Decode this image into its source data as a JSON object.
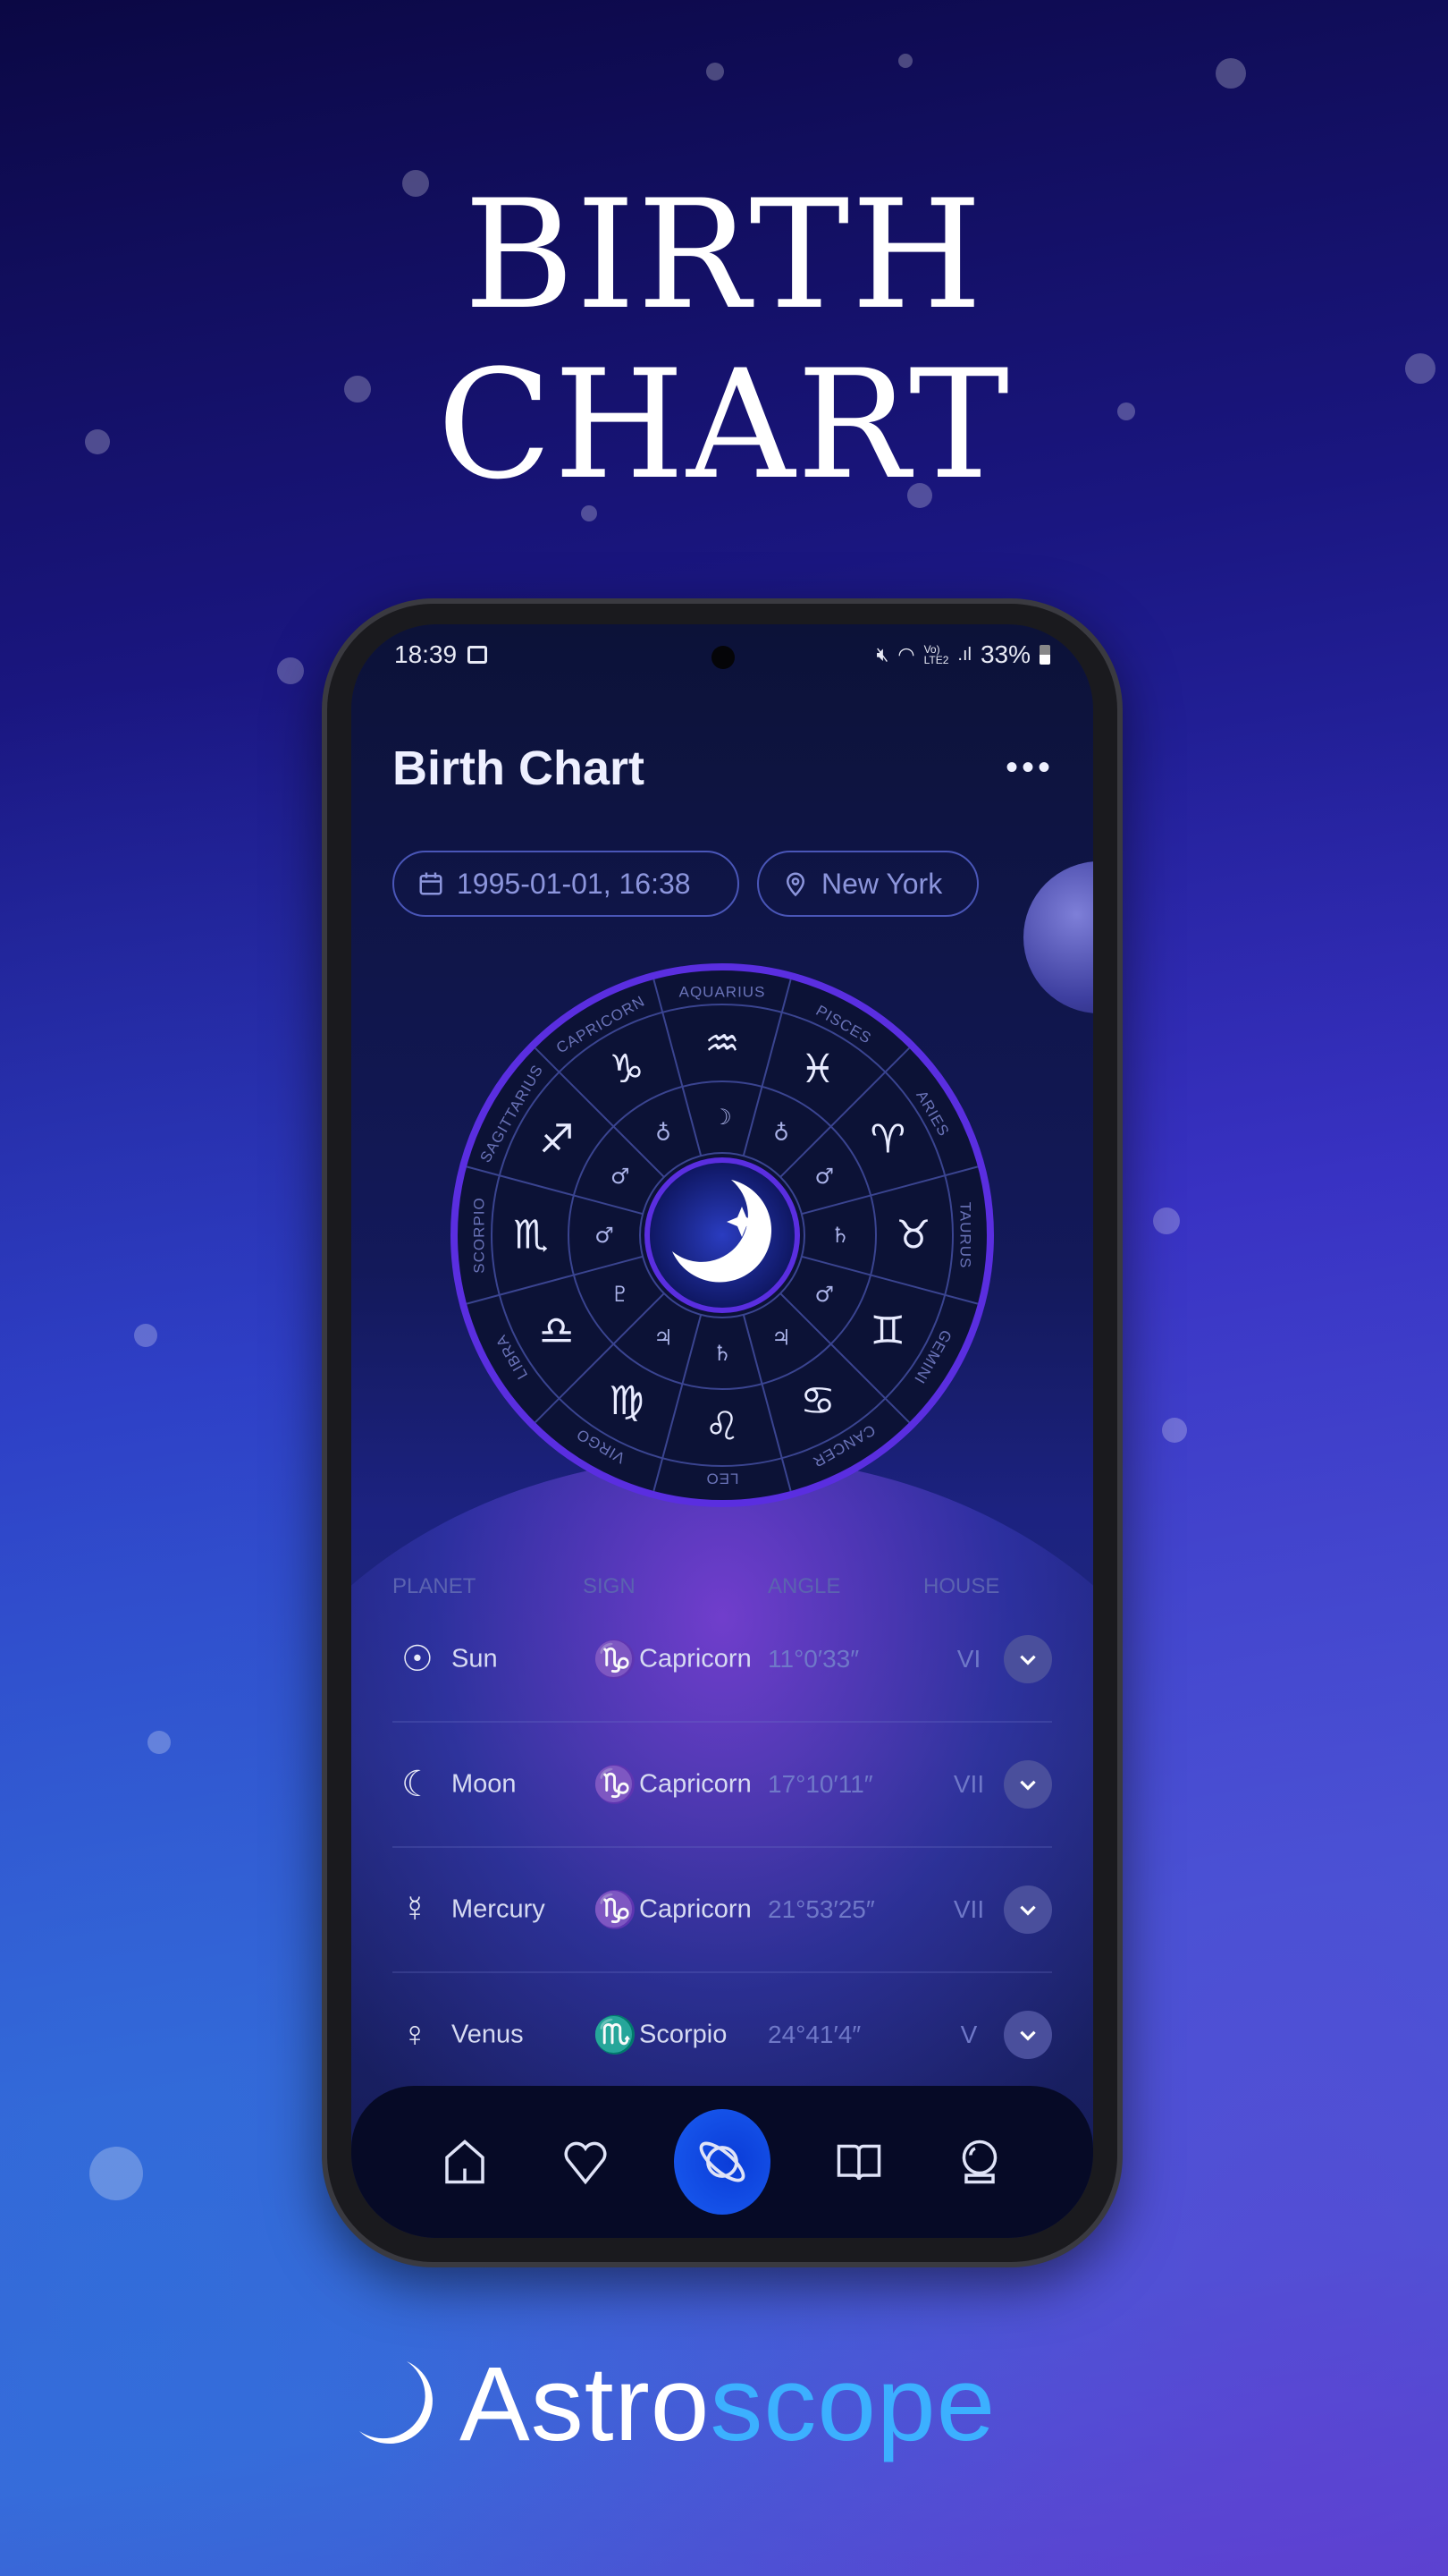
{
  "headline": [
    "BIRTH",
    "CHART"
  ],
  "status_bar": {
    "time": "18:39",
    "battery": "33%",
    "icons": [
      "gallery-icon",
      "mute-icon",
      "wifi-icon",
      "volte-lte2-icon",
      "signal-icon",
      "battery-icon"
    ]
  },
  "header": {
    "title": "Birth Chart",
    "more_icon": "more-horizontal-icon"
  },
  "filters": {
    "date": "1995-01-01, 16:38",
    "location": "New York"
  },
  "wheel": {
    "signs": [
      "AQUARIUS",
      "PISCES",
      "ARIES",
      "TAURUS",
      "GEMINI",
      "CANCER",
      "LEO",
      "VIRGO",
      "LIBRA",
      "SCORPIO",
      "SAGITTARIUS",
      "CAPRICORN"
    ],
    "sign_glyphs": [
      "♒",
      "♓",
      "♈",
      "♉",
      "♊",
      "♋",
      "♌",
      "♍",
      "♎",
      "♏",
      "♐",
      "♑"
    ],
    "planet_glyphs": [
      "☽",
      "♁",
      "♂",
      "♄",
      "♂",
      "♃",
      "♄",
      "♃",
      "♇",
      "♂",
      "♂",
      "♁"
    ],
    "ring_color": "#5a2ee0"
  },
  "table": {
    "headers": {
      "planet": "PLANET",
      "sign": "SIGN",
      "angle": "ANGLE",
      "house": "HOUSE"
    },
    "rows": [
      {
        "planet": "Sun",
        "planet_glyph": "☉",
        "sign": "Capricorn",
        "sign_glyph": "♑",
        "angle": "11°0′33″",
        "house": "VI"
      },
      {
        "planet": "Moon",
        "planet_glyph": "☾",
        "sign": "Capricorn",
        "sign_glyph": "♑",
        "angle": "17°10′11″",
        "house": "VII"
      },
      {
        "planet": "Mercury",
        "planet_glyph": "☿",
        "sign": "Capricorn",
        "sign_glyph": "♑",
        "angle": "21°53′25″",
        "house": "VII"
      },
      {
        "planet": "Venus",
        "planet_glyph": "♀",
        "sign": "Scorpio",
        "sign_glyph": "♏",
        "angle": "24°41′4″",
        "house": "V"
      }
    ]
  },
  "nav": {
    "items": [
      "home-icon",
      "heart-icon",
      "planet-icon",
      "book-icon",
      "crystal-ball-icon"
    ],
    "active": "planet-icon",
    "active_color": "#0a3cd8"
  },
  "brand": {
    "part1": "Astro",
    "part2": "scope",
    "accent": "#3cb0ff"
  }
}
